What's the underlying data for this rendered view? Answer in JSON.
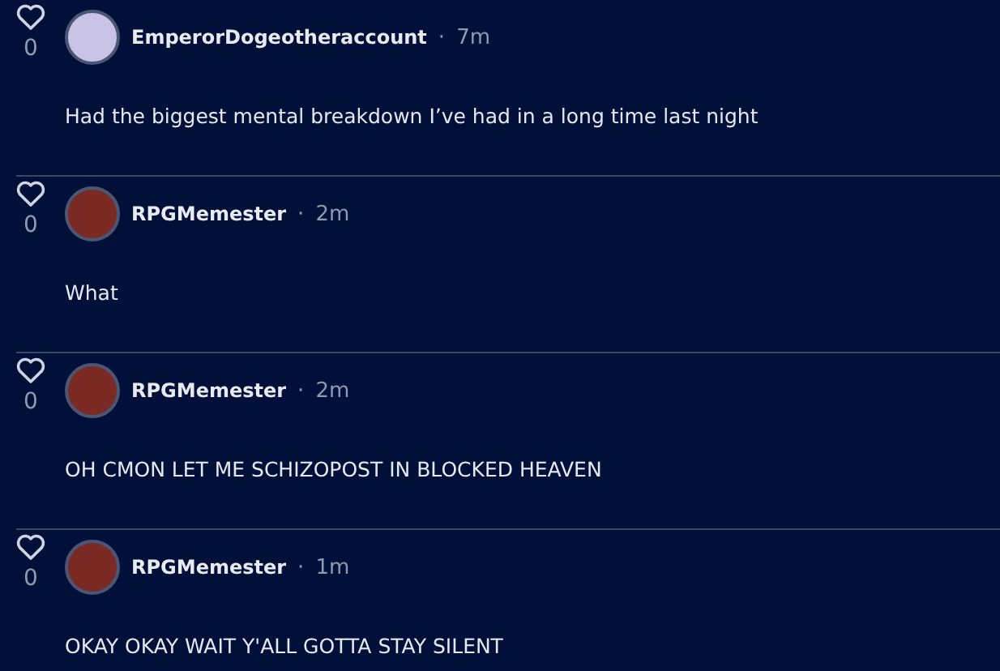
{
  "posts": [
    {
      "likes": "0",
      "avatar": {
        "color": "#c9c3e6"
      },
      "username": "EmperorDogeotheraccount",
      "separator": "·",
      "time": "7m",
      "message": "Had the biggest mental breakdown I’ve had in a long time last night"
    },
    {
      "likes": "0",
      "avatar": {
        "color": "#7a2a22"
      },
      "username": "RPGMemester",
      "separator": "·",
      "time": "2m",
      "message": "What"
    },
    {
      "likes": "0",
      "avatar": {
        "color": "#7a2a22"
      },
      "username": "RPGMemester",
      "separator": "·",
      "time": "2m",
      "message": "OH CMON LET ME SCHIZOPOST IN BLOCKED HEAVEN"
    },
    {
      "likes": "0",
      "avatar": {
        "color": "#7a2a22"
      },
      "username": "RPGMemester",
      "separator": "·",
      "time": "1m",
      "message": "OKAY OKAY WAIT Y'ALL GOTTA STAY SILENT"
    }
  ]
}
